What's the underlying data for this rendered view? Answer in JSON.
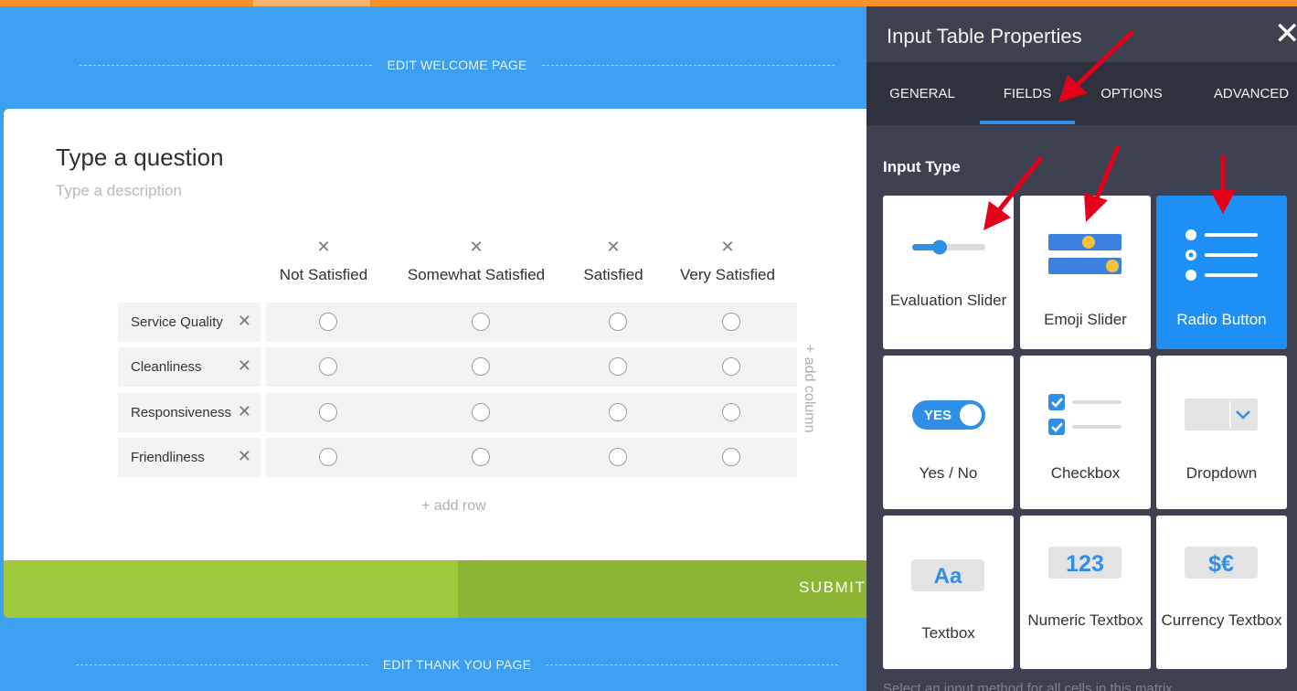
{
  "canvas": {
    "edit_welcome": "EDIT WELCOME PAGE",
    "edit_thanks": "EDIT THANK YOU PAGE",
    "question_title": "Type a question",
    "question_desc": "Type a description",
    "columns": [
      "Not Satisfied",
      "Somewhat Satisfied",
      "Satisfied",
      "Very Satisfied"
    ],
    "rows": [
      "Service Quality",
      "Cleanliness",
      "Responsiveness",
      "Friendliness"
    ],
    "add_row": "+ add row",
    "add_column": "+ add column",
    "submit": "SUBMIT",
    "remove_glyph": "✕"
  },
  "panel": {
    "title": "Input Table Properties",
    "close": "✕",
    "tabs": [
      "GENERAL",
      "FIELDS",
      "OPTIONS",
      "ADVANCED"
    ],
    "active_tab": "FIELDS",
    "section_title": "Input Type",
    "input_types": [
      {
        "label": "Evaluation Slider",
        "icon": "slider-icon",
        "selected": false
      },
      {
        "label": "Emoji Slider",
        "icon": "emoji-slider-icon",
        "selected": false
      },
      {
        "label": "Radio Button",
        "icon": "radio-list-icon",
        "selected": true
      },
      {
        "label": "Yes / No",
        "icon": "toggle-icon",
        "selected": false
      },
      {
        "label": "Checkbox",
        "icon": "checkbox-icon",
        "selected": false
      },
      {
        "label": "Dropdown",
        "icon": "dropdown-icon",
        "selected": false
      },
      {
        "label": "Textbox",
        "icon": "textbox-icon",
        "selected": false
      },
      {
        "label": "Numeric Textbox",
        "icon": "numeric-icon",
        "selected": false
      },
      {
        "label": "Currency Textbox",
        "icon": "currency-icon",
        "selected": false
      }
    ],
    "icon_text": {
      "yes": "YES",
      "aa": "Aa",
      "num": "123",
      "cur": "$€"
    },
    "hint": "Select an input method for all cells in this matrix"
  },
  "colors": {
    "background": "#3d9ff0",
    "accent": "#1e90f5",
    "submit_green": "#9dc93b",
    "topbar": "#f5902a",
    "panel": "#3d4150",
    "arrow": "#e3001b"
  }
}
